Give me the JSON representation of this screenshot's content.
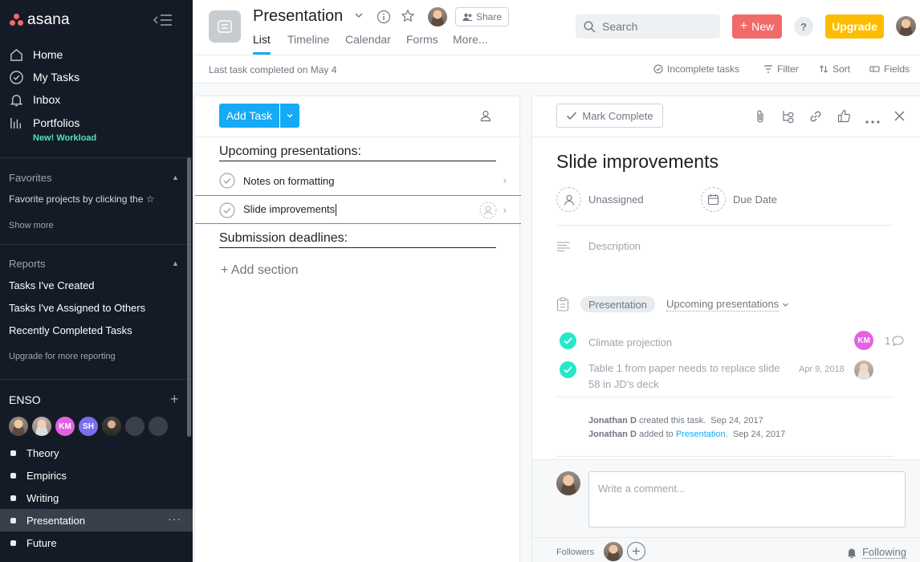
{
  "sidebar": {
    "logo": "asana",
    "nav": [
      {
        "label": "Home",
        "icon": "home-icon"
      },
      {
        "label": "My Tasks",
        "icon": "check-circle-icon"
      },
      {
        "label": "Inbox",
        "icon": "bell-icon"
      },
      {
        "label": "Portfolios",
        "icon": "bar-chart-icon"
      }
    ],
    "new_workload": "New! Workload",
    "favorites": {
      "title": "Favorites",
      "hint": "Favorite projects by clicking the ☆",
      "show_more": "Show more"
    },
    "reports": {
      "title": "Reports",
      "items": [
        "Tasks I've Created",
        "Tasks I've Assigned to Others",
        "Recently Completed Tasks"
      ],
      "upgrade": "Upgrade for more reporting"
    },
    "team": {
      "name": "ENSO",
      "add": "+",
      "members": [
        {
          "type": "photo"
        },
        {
          "type": "photo"
        },
        {
          "initials": "KM",
          "color": "#e362e3"
        },
        {
          "initials": "SH",
          "color": "#7a6ff0"
        },
        {
          "type": "photo"
        },
        {
          "type": "empty"
        },
        {
          "type": "empty"
        }
      ],
      "projects": [
        {
          "label": "Theory"
        },
        {
          "label": "Empirics"
        },
        {
          "label": "Writing"
        },
        {
          "label": "Presentation",
          "active": true,
          "more": "···"
        },
        {
          "label": "Future"
        }
      ]
    }
  },
  "topbar": {
    "project_title": "Presentation",
    "share_label": "Share",
    "tabs": [
      "List",
      "Timeline",
      "Calendar",
      "Forms",
      "More..."
    ],
    "active_tab": "List",
    "search_placeholder": "Search",
    "new_label": "New",
    "help_label": "?",
    "upgrade_label": "Upgrade"
  },
  "statusbar": {
    "last_completed": "Last task completed on May 4",
    "incomplete": "Incomplete tasks",
    "filter": "Filter",
    "sort": "Sort",
    "fields": "Fields"
  },
  "task_list": {
    "add_task": "Add Task",
    "sections": [
      {
        "title": "Upcoming presentations:"
      },
      {
        "title": "Submission deadlines:"
      }
    ],
    "tasks": [
      {
        "name": "Notes on formatting",
        "section": 0
      },
      {
        "name": "Slide improvements",
        "section": 0,
        "selected": true
      }
    ],
    "add_section": "+ Add section"
  },
  "detail": {
    "mark_complete": "Mark Complete",
    "title": "Slide improvements",
    "assignee": "Unassigned",
    "due_date": "Due Date",
    "description_placeholder": "Description",
    "project_pill": "Presentation",
    "section_select": "Upcoming presentations",
    "subtasks": [
      {
        "name": "Climate projection",
        "assignee": "KM",
        "comments": "1"
      },
      {
        "name": "Table 1 from paper needs to replace slide 58 in JD's deck",
        "date": "Apr 9, 2018"
      }
    ],
    "activity": [
      {
        "user": "Jonathan D",
        "action": "created this task.",
        "date": "Sep 24, 2017"
      },
      {
        "user": "Jonathan D",
        "action": "added to",
        "target": "Presentation",
        "punct": ".",
        "date": "Sep 24, 2017"
      }
    ],
    "comment_placeholder": "Write a comment...",
    "followers_label": "Followers",
    "following_label": "Following"
  },
  "colors": {
    "sidebar_bg": "#151b26",
    "accent_blue": "#14aaf5",
    "new_button": "#f06a6a",
    "upgrade_button": "#fcbd01",
    "complete_green": "#25e8c8",
    "workload_green": "#52e0c4"
  }
}
